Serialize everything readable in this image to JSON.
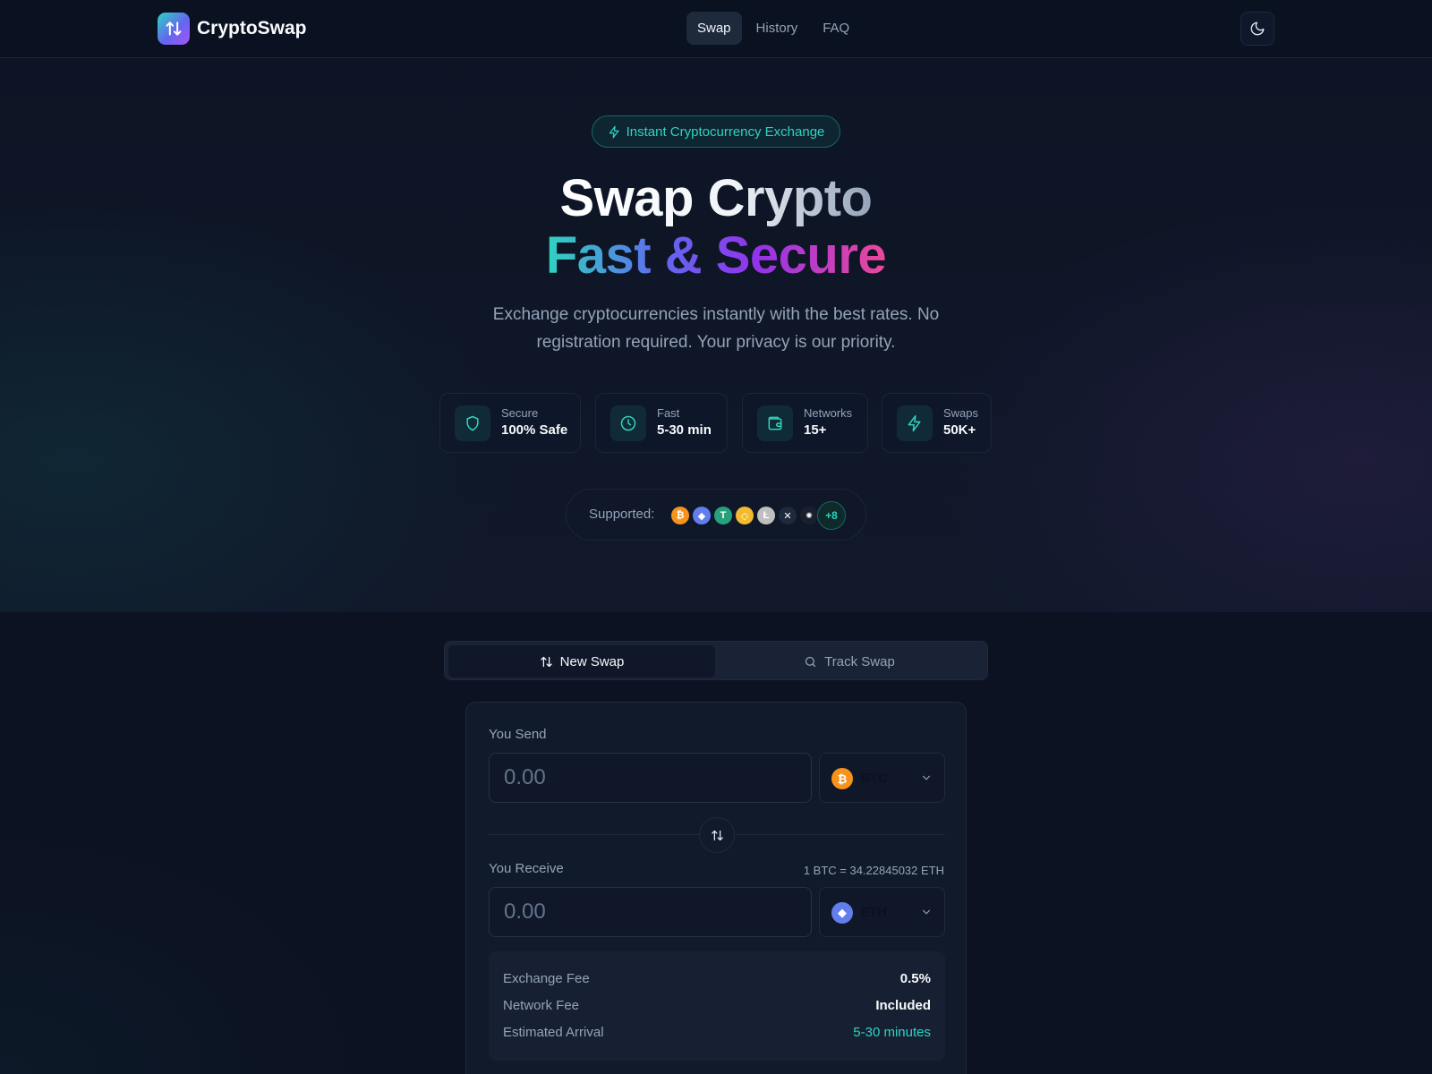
{
  "nav": {
    "brand": "CryptoSwap",
    "links": [
      "Swap",
      "History",
      "FAQ"
    ]
  },
  "hero": {
    "badge": "Instant Cryptocurrency Exchange",
    "title_line1": "Swap Crypto",
    "title_line2": "Fast & Secure",
    "lead": "Exchange cryptocurrencies instantly with the best rates. No registration required. Your privacy is our priority.",
    "stats": [
      {
        "label": "Secure",
        "value": "100% Safe",
        "icon": "shield-icon"
      },
      {
        "label": "Fast",
        "value": "5-30 min",
        "icon": "clock-icon"
      },
      {
        "label": "Networks",
        "value": "15+",
        "icon": "wallet-icon"
      },
      {
        "label": "Swaps",
        "value": "50K+",
        "icon": "lightning-icon"
      }
    ],
    "supported_label": "Supported:",
    "supported_more": "+8"
  },
  "tabs": {
    "new_swap": "New Swap",
    "track_swap": "Track Swap"
  },
  "swap": {
    "send_label": "You Send",
    "send_placeholder": "0.00",
    "send_ticker": "BTC",
    "receive_label": "You Receive",
    "receive_placeholder": "0.00",
    "receive_ticker": "ETH",
    "rate": "1 BTC = 34.22845032 ETH"
  },
  "details": {
    "exchange_fee_label": "Exchange Fee",
    "exchange_fee_value": "0.5%",
    "network_fee_label": "Network Fee",
    "network_fee_value": "Included",
    "arrival_label": "Estimated Arrival",
    "arrival_value": "5-30 minutes"
  },
  "colors": {
    "accent": "#2dd4bf",
    "background": "#0b1120",
    "btc": "#f7931a",
    "eth": "#627eea",
    "usdt": "#26a17b",
    "bnb": "#f3ba2f"
  }
}
